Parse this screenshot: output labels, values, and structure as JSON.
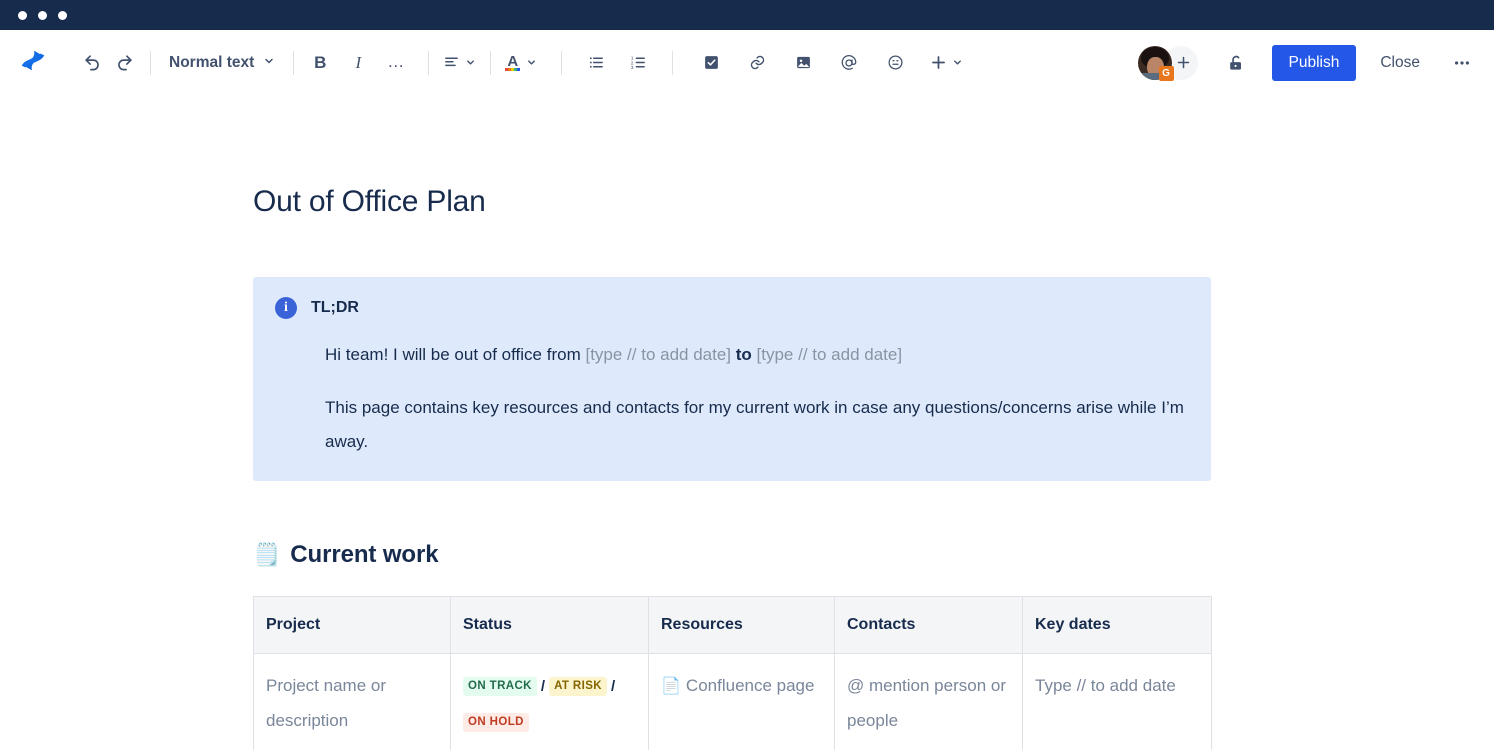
{
  "window": {
    "traffic_lights": [
      "close",
      "minimize",
      "maximize"
    ]
  },
  "toolbar": {
    "logo": "confluence-logo",
    "undo": "undo-icon",
    "redo": "redo-icon",
    "style_label": "Normal text",
    "bold_label": "B",
    "italic_label": "I",
    "more_formatting_label": "…",
    "align_label": "align-left-icon",
    "text_color_label": "A",
    "bullet_list": "bullet-list-icon",
    "numbered_list": "numbered-list-icon",
    "action_item": "task-checkbox-icon",
    "link": "link-icon",
    "image": "image-icon",
    "mention": "@",
    "emoji": "emoji-icon",
    "insert_label": "+",
    "avatar_badge": "G",
    "add_collaborator": "+",
    "restrictions": "unlocked-padlock-icon",
    "publish_label": "Publish",
    "close_label": "Close",
    "overflow_label": "…"
  },
  "document": {
    "title": "Out of Office Plan",
    "info_panel": {
      "icon": "info-icon",
      "heading": "TL;DR",
      "line1_prefix": "Hi team! I will be out of office from ",
      "line1_date1": "[type // to add date]",
      "line1_middle": "to",
      "line1_date2": "[type // to add date]",
      "line2": "This page contains key resources and contacts for my current work in case any questions/concerns arise while I’m away."
    },
    "section": {
      "emoji": "🗒️",
      "heading": "Current work"
    },
    "table": {
      "columns": [
        "Project",
        "Status",
        "Resources",
        "Contacts",
        "Key dates"
      ],
      "rows": [
        {
          "project": "Project name or description",
          "status": {
            "lozenges": [
              {
                "label": "ON TRACK",
                "tone": "green",
                "color": "#E3FCEF"
              },
              {
                "label": "AT RISK",
                "tone": "yellow",
                "color": "#FBF4CD"
              },
              {
                "label": "ON HOLD",
                "tone": "red",
                "color": "#FFEBE6"
              }
            ],
            "separator": "/"
          },
          "resources_emoji": "📄",
          "resources": "Confluence page",
          "contacts": "@ mention person or people",
          "key_dates": "Type // to add date"
        }
      ]
    }
  },
  "colors": {
    "chrome": "#172B4D",
    "accent": "#2456E8",
    "panel_bg": "#DEEAFB",
    "text": "#172B4D",
    "muted": "#7A869A",
    "border": "#DFE1E6",
    "badge_orange": "#E8761D"
  }
}
